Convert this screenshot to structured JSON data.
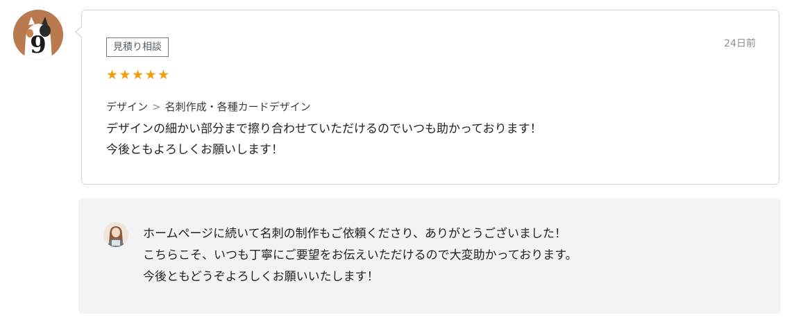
{
  "reviewer": {
    "avatar_icon": "calico-cat-avatar-icon",
    "avatar_digit": "9"
  },
  "review": {
    "tag": "見積り相談",
    "date": "24日前",
    "rating": 5,
    "rating_max": 5,
    "star_glyph": "★",
    "star_color": "#f39c12",
    "category": {
      "parent": "デザイン",
      "separator": ">",
      "child": "名刺作成・各種カードデザイン"
    },
    "comment_lines": [
      "デザインの細かい部分まで擦り合わせていただけるのでいつも助かっております！",
      "今後ともよろしくお願いします！"
    ]
  },
  "reply": {
    "avatar_icon": "seller-avatar-icon",
    "lines": [
      "ホームページに続いて名刺の制作もご依頼くださり、ありがとうございました！",
      "こちらこそ、いつも丁寧にご要望をお伝えいただけるので大変助かっております。",
      "今後ともどうぞよろしくお願いいたします！"
    ]
  }
}
